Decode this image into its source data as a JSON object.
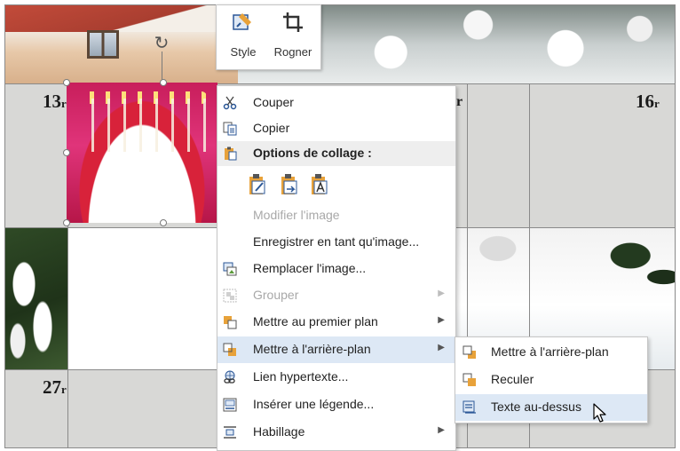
{
  "calendar": {
    "day_numbers": {
      "d13": "13",
      "d16": "16",
      "d27": "27"
    },
    "partial_glyph": "r",
    "partial_small_r": "r"
  },
  "mini_toolbar": {
    "style_label": "Style",
    "crop_label": "Rogner"
  },
  "context_menu": {
    "cut": "Couper",
    "copy": "Copier",
    "paste_options_header": "Options de collage :",
    "edit_image": "Modifier l'image",
    "save_as_image": "Enregistrer en tant qu'image...",
    "replace_image": "Remplacer l'image...",
    "group": "Grouper",
    "bring_to_front": "Mettre au premier plan",
    "send_to_back": "Mettre à l'arrière-plan",
    "hyperlink": "Lien hypertexte...",
    "insert_caption": "Insérer une légende...",
    "wrap_text": "Habillage"
  },
  "submenu": {
    "send_to_back": "Mettre à l'arrière-plan",
    "send_backward": "Reculer",
    "behind_text": "Texte au-dessus"
  },
  "colors": {
    "menu_highlight": "#dde8f5",
    "disabled_text": "#a8a8a8",
    "calendar_gray": "#d8d8d6",
    "icon_blue": "#2b5797",
    "icon_orange": "#e8a23a"
  },
  "icons": {
    "rotate": "rotate-handle-icon",
    "style": "picture-style-icon",
    "crop": "crop-icon",
    "cut": "scissors-icon",
    "copy": "copy-icon",
    "paste": "paste-icon",
    "replace": "replace-image-icon",
    "group": "group-icon",
    "front": "bring-to-front-icon",
    "back": "send-to-back-icon",
    "link": "hyperlink-icon",
    "caption": "caption-icon",
    "wrap": "wrap-text-icon",
    "cursor": "mouse-pointer-icon"
  }
}
